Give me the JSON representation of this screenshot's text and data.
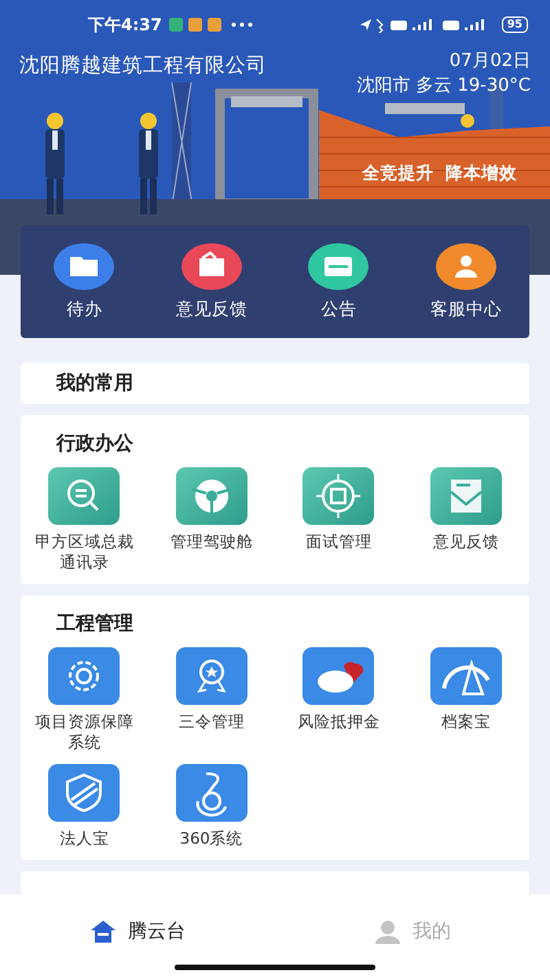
{
  "status_bar": {
    "time": "下午4:37",
    "battery": "95"
  },
  "header": {
    "company": "沈阳腾越建筑工程有限公司",
    "date": "07月02日",
    "weather": "沈阳市 多云 19-30°C",
    "slogan": "全竞提升  降本增效"
  },
  "quick_actions": [
    {
      "label": "待办",
      "color": "#3d7fe8"
    },
    {
      "label": "意见反馈",
      "color": "#e84858"
    },
    {
      "label": "公告",
      "color": "#2fc79f"
    },
    {
      "label": "客服中心",
      "color": "#f08a2c"
    }
  ],
  "favorites": {
    "title": "我的常用"
  },
  "sections": [
    {
      "title": "行政办公",
      "items": [
        {
          "label": "甲方区域总裁通讯录"
        },
        {
          "label": "管理驾驶舱"
        },
        {
          "label": "面试管理"
        },
        {
          "label": "意见反馈"
        }
      ]
    },
    {
      "title": "工程管理",
      "items": [
        {
          "label": "项目资源保障系统"
        },
        {
          "label": "三令管理"
        },
        {
          "label": "风险抵押金"
        },
        {
          "label": "档案宝"
        },
        {
          "label": "法人宝"
        },
        {
          "label": "360系统"
        }
      ]
    }
  ],
  "tab_bar": [
    {
      "label": "腾云台",
      "selected": true
    },
    {
      "label": "我的",
      "selected": false
    }
  ]
}
